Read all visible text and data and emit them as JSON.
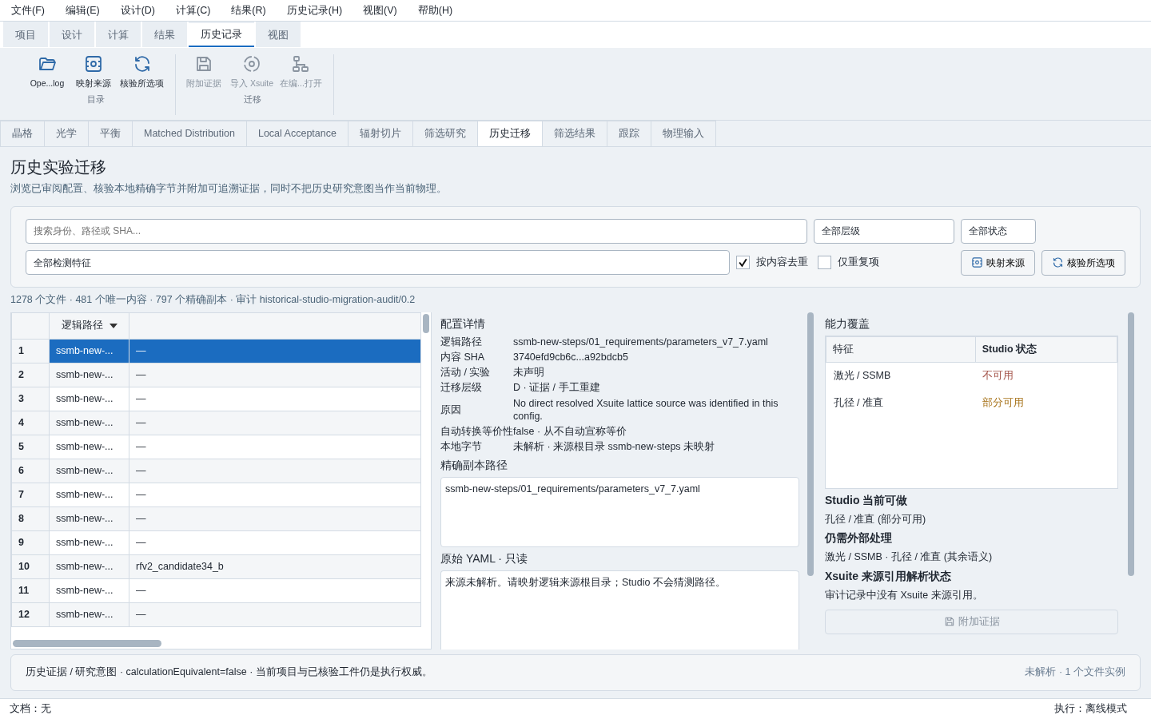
{
  "menu": [
    "文件(F)",
    "编辑(E)",
    "设计(D)",
    "计算(C)",
    "结果(R)",
    "历史记录(H)",
    "视图(V)",
    "帮助(H)"
  ],
  "ribbon_tabs": [
    {
      "label": "项目",
      "selected": false
    },
    {
      "label": "设计",
      "selected": false
    },
    {
      "label": "计算",
      "selected": false
    },
    {
      "label": "结果",
      "selected": false
    },
    {
      "label": "历史记录",
      "selected": true
    },
    {
      "label": "视图",
      "selected": false
    }
  ],
  "ribbon_groups": [
    {
      "label": "目录",
      "buttons": [
        {
          "label": "Ope...log",
          "disabled": false
        },
        {
          "label": "映射来源",
          "disabled": false
        },
        {
          "label": "核验所选项",
          "disabled": false
        }
      ]
    },
    {
      "label": "迁移",
      "buttons": [
        {
          "label": "附加证据",
          "disabled": true
        },
        {
          "label": "导入 Xsuite",
          "disabled": true
        },
        {
          "label": "在编...打开",
          "disabled": true
        }
      ]
    }
  ],
  "doc_tabs": [
    {
      "label": "晶格",
      "selected": false
    },
    {
      "label": "光学",
      "selected": false
    },
    {
      "label": "平衡",
      "selected": false
    },
    {
      "label": "Matched Distribution",
      "selected": false
    },
    {
      "label": "Local Acceptance",
      "selected": false
    },
    {
      "label": "辐射切片",
      "selected": false
    },
    {
      "label": "筛选研究",
      "selected": false
    },
    {
      "label": "历史迁移",
      "selected": true
    },
    {
      "label": "筛选结果",
      "selected": false
    },
    {
      "label": "跟踪",
      "selected": false
    },
    {
      "label": "物理输入",
      "selected": false
    }
  ],
  "page": {
    "title": "历史实验迁移",
    "subtitle": "浏览已审阅配置、核验本地精确字节并附加可追溯证据，同时不把历史研究意图当作当前物理。"
  },
  "filters": {
    "search": {
      "placeholder": "搜索身份、路径或 SHA..."
    },
    "tier_select": "全部层级",
    "status_select": "全部状态",
    "feature_select": "全部检测特征",
    "checkboxes": [
      {
        "label": "按内容去重",
        "checked": true
      },
      {
        "label": "仅重复项",
        "checked": false
      }
    ],
    "buttons": [
      "映射来源",
      "核验所选项"
    ]
  },
  "summary": "1278 个文件 · 481 个唯一内容 · 797 个精确副本 · 审计 historical-studio-migration-audit/0.2",
  "table": {
    "columns": [
      "逻辑路径"
    ],
    "rows": [
      {
        "index": "1",
        "path": "ssmb-new-...",
        "value": "—",
        "selected": true
      },
      {
        "index": "2",
        "path": "ssmb-new-...",
        "value": "—",
        "selected": false
      },
      {
        "index": "3",
        "path": "ssmb-new-...",
        "value": "—",
        "selected": false
      },
      {
        "index": "4",
        "path": "ssmb-new-...",
        "value": "—",
        "selected": false
      },
      {
        "index": "5",
        "path": "ssmb-new-...",
        "value": "—",
        "selected": false
      },
      {
        "index": "6",
        "path": "ssmb-new-...",
        "value": "—",
        "selected": false
      },
      {
        "index": "7",
        "path": "ssmb-new-...",
        "value": "—",
        "selected": false
      },
      {
        "index": "8",
        "path": "ssmb-new-...",
        "value": "—",
        "selected": false
      },
      {
        "index": "9",
        "path": "ssmb-new-...",
        "value": "—",
        "selected": false
      },
      {
        "index": "10",
        "path": "ssmb-new-...",
        "value": "rfv2_candidate34_b",
        "selected": false
      },
      {
        "index": "11",
        "path": "ssmb-new-...",
        "value": "—",
        "selected": false
      },
      {
        "index": "12",
        "path": "ssmb-new-...",
        "value": "—",
        "selected": false
      }
    ]
  },
  "details": {
    "title": "配置详情",
    "fields": [
      {
        "label": "逻辑路径",
        "value": "ssmb-new-steps/01_requirements/parameters_v7_7.yaml"
      },
      {
        "label": "内容 SHA",
        "value": "3740efd9cb6c...a92bdcb5"
      },
      {
        "label": "活动 / 实验",
        "value": "未声明"
      },
      {
        "label": "迁移层级",
        "value": "D · 证据 / 手工重建"
      },
      {
        "label": "原因",
        "value": "No direct resolved Xsuite lattice source was identified in this config."
      },
      {
        "label": "自动转换等价性",
        "value": "false · 从不自动宣称等价"
      },
      {
        "label": "本地字节",
        "value": "未解析 · 来源根目录 ssmb-new-steps 未映射"
      }
    ],
    "copy_path_title": "精确副本路径",
    "copy_path": "ssmb-new-steps/01_requirements/parameters_v7_7.yaml",
    "yaml_title": "原始 YAML · 只读",
    "yaml": "来源未解析。请映射逻辑来源根目录；Studio 不会猜测路径。"
  },
  "capability": {
    "title": "能力覆盖",
    "columns": [
      "特征",
      "Studio 状态"
    ],
    "rows": [
      {
        "feature": "激光 / SSMB",
        "status": "不可用",
        "color": "#a4544a"
      },
      {
        "feature": "孔径 / 准直",
        "status": "部分可用",
        "color": "#a8741c"
      }
    ],
    "sections": [
      {
        "title": "Studio 当前可做",
        "text": "孔径 / 准直 (部分可用)"
      },
      {
        "title": "仍需外部处理",
        "text": "激光 / SSMB · 孔径 / 准直 (其余语义)"
      },
      {
        "title": "Xsuite 来源引用解析状态",
        "text": "审计记录中没有 Xsuite 来源引用。"
      }
    ],
    "attach_button": {
      "label": "附加证据",
      "disabled": true
    }
  },
  "footer": {
    "left": "历史证据 / 研究意图 · calculationEquivalent=false · 当前项目与已核验工件仍是执行权威。",
    "right": "未解析 · 1 个文件实例"
  },
  "status_bar": {
    "left": "文档：无",
    "right": "执行：离线模式"
  }
}
